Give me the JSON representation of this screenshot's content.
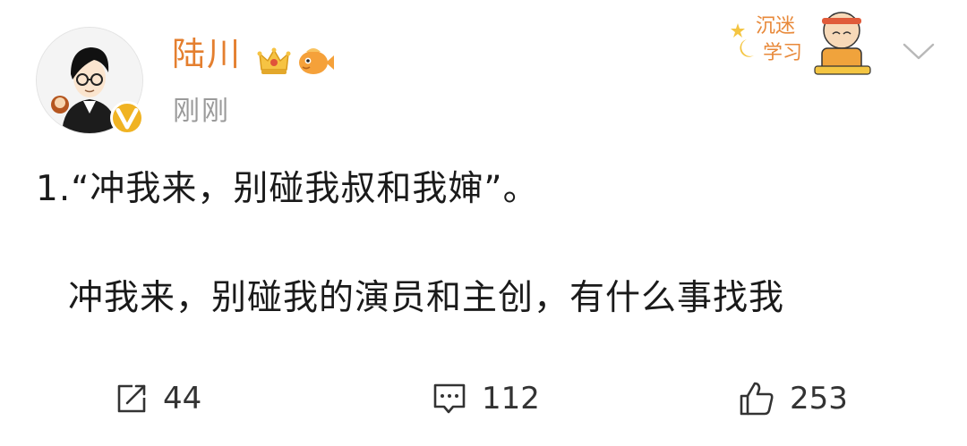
{
  "header": {
    "user_name": "陆川",
    "timestamp": "刚刚",
    "avatar_icon": "avatar-cartoon-man",
    "verified_icon": "verified-v-badge",
    "membership_icon": "crown-icon",
    "fan_badge_icon": "fish-icon",
    "sticker_text": "沉迷学习",
    "menu_icon": "chevron-down-icon"
  },
  "content": {
    "line_1": "1.“冲我来，别碰我叔和我婶”。",
    "line_2": "冲我来，别碰我的演员和主创，有什么事找我"
  },
  "actions": {
    "repost_count": "44",
    "comment_count": "112",
    "like_count": "253"
  },
  "colors": {
    "user_name": "#e47f2f",
    "timestamp": "#9a9a9a",
    "text": "#1a1a1a",
    "action_icon": "#333333",
    "verified": "#f0b323"
  }
}
